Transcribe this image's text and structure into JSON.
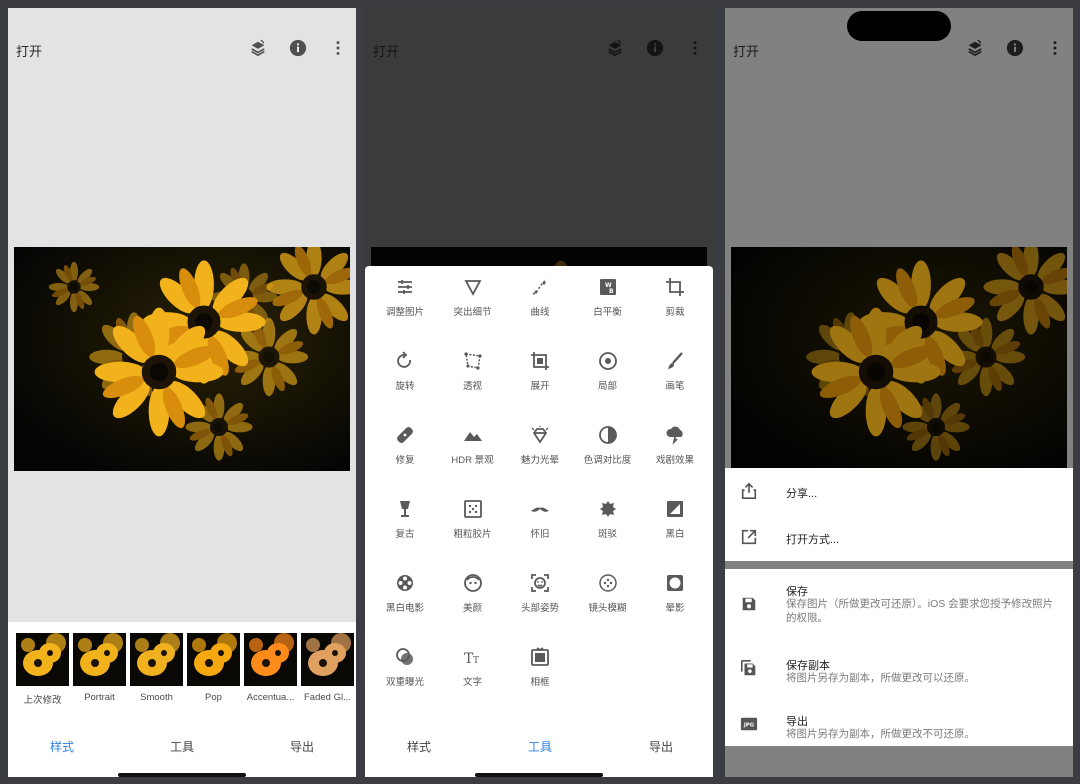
{
  "panel1": {
    "title": "打开",
    "styles": [
      {
        "label": "上次修改"
      },
      {
        "label": "Portrait"
      },
      {
        "label": "Smooth"
      },
      {
        "label": "Pop"
      },
      {
        "label": "Accentua..."
      },
      {
        "label": "Faded Gl..."
      }
    ],
    "nav": [
      "样式",
      "工具",
      "导出"
    ],
    "active_tab": "样式"
  },
  "panel2": {
    "title": "打开",
    "tools": [
      {
        "label": "调整图片",
        "icon": "tune-icon"
      },
      {
        "label": "突出细节",
        "icon": "details-triangle-icon"
      },
      {
        "label": "曲线",
        "icon": "curves-icon"
      },
      {
        "label": "白平衡",
        "icon": "white-balance-icon"
      },
      {
        "label": "剪裁",
        "icon": "crop-icon"
      },
      {
        "label": "旋转",
        "icon": "rotate-icon"
      },
      {
        "label": "透视",
        "icon": "perspective-icon"
      },
      {
        "label": "展开",
        "icon": "expand-icon"
      },
      {
        "label": "局部",
        "icon": "selective-icon"
      },
      {
        "label": "画笔",
        "icon": "brush-icon"
      },
      {
        "label": "修复",
        "icon": "healing-icon"
      },
      {
        "label": "HDR 景观",
        "icon": "hdr-mountain-icon"
      },
      {
        "label": "魅力光晕",
        "icon": "glamour-glow-icon"
      },
      {
        "label": "色调对比度",
        "icon": "tonal-contrast-icon"
      },
      {
        "label": "戏剧效果",
        "icon": "drama-cloud-icon"
      },
      {
        "label": "复古",
        "icon": "vintage-lamp-icon"
      },
      {
        "label": "粗粒胶片",
        "icon": "grainy-film-icon"
      },
      {
        "label": "怀旧",
        "icon": "mustache-icon"
      },
      {
        "label": "斑驳",
        "icon": "grunge-icon"
      },
      {
        "label": "黑白",
        "icon": "black-white-icon"
      },
      {
        "label": "黑白电影",
        "icon": "film-reel-icon"
      },
      {
        "label": "美颜",
        "icon": "face-icon"
      },
      {
        "label": "头部姿势",
        "icon": "head-pose-icon"
      },
      {
        "label": "镜头模糊",
        "icon": "lens-blur-icon"
      },
      {
        "label": "晕影",
        "icon": "vignette-icon"
      },
      {
        "label": "双重曝光",
        "icon": "double-exposure-icon"
      },
      {
        "label": "文字",
        "icon": "text-icon"
      },
      {
        "label": "相框",
        "icon": "frame-icon"
      }
    ],
    "nav": [
      "样式",
      "工具",
      "导出"
    ],
    "active_tab": "工具"
  },
  "panel3": {
    "title": "打开",
    "share_label": "分享...",
    "open_with_label": "打开方式...",
    "save_title": "保存",
    "save_desc": "保存图片（所做更改可还原）。iOS 会要求您授予修改照片的权限。",
    "save_copy_title": "保存副本",
    "save_copy_desc": "将图片另存为副本，所做更改可以还原。",
    "export_title": "导出",
    "export_desc": "将图片另存为副本，所做更改不可还原。"
  },
  "colors": {
    "accent": "#2f82e6",
    "icon": "#5a5a5a"
  }
}
